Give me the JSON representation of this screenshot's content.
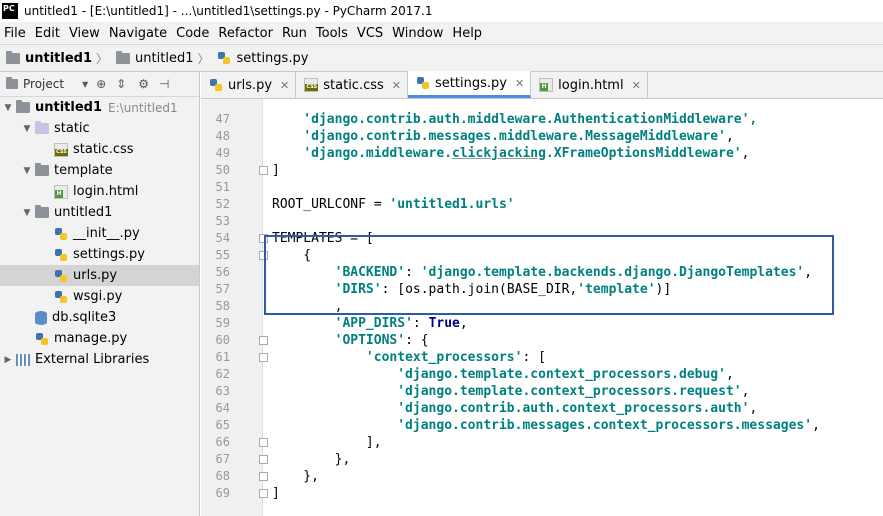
{
  "window": {
    "title": "untitled1 - [E:\\untitled1] - ...\\untitled1\\settings.py - PyCharm 2017.1",
    "app_icon_text": "PC"
  },
  "menu": [
    {
      "label": "File"
    },
    {
      "label": "Edit"
    },
    {
      "label": "View"
    },
    {
      "label": "Navigate"
    },
    {
      "label": "Code"
    },
    {
      "label": "Refactor"
    },
    {
      "label": "Run"
    },
    {
      "label": "Tools"
    },
    {
      "label": "VCS"
    },
    {
      "label": "Window"
    },
    {
      "label": "Help"
    }
  ],
  "breadcrumb": [
    {
      "label": "untitled1",
      "bold": true
    },
    {
      "label": "untitled1"
    },
    {
      "label": "settings.py"
    }
  ],
  "project_panel": {
    "title": "Project",
    "tree": [
      {
        "label": "untitled1",
        "path": "E:\\untitled1",
        "depth": 0,
        "expanded": true,
        "icon": "folder-icon"
      },
      {
        "label": "static",
        "depth": 1,
        "expanded": true,
        "icon": "folder-icon"
      },
      {
        "label": "static.css",
        "depth": 2,
        "icon": "css-file-icon"
      },
      {
        "label": "template",
        "depth": 1,
        "expanded": true,
        "icon": "folder-icon"
      },
      {
        "label": "login.html",
        "depth": 2,
        "icon": "html-file-icon"
      },
      {
        "label": "untitled1",
        "depth": 1,
        "expanded": true,
        "icon": "folder-icon"
      },
      {
        "label": "__init__.py",
        "depth": 2,
        "icon": "python-file-icon"
      },
      {
        "label": "settings.py",
        "depth": 2,
        "icon": "python-file-icon"
      },
      {
        "label": "urls.py",
        "depth": 2,
        "icon": "python-file-icon",
        "selected": true
      },
      {
        "label": "wsgi.py",
        "depth": 2,
        "icon": "python-file-icon"
      },
      {
        "label": "db.sqlite3",
        "depth": 1,
        "icon": "database-icon"
      },
      {
        "label": "manage.py",
        "depth": 1,
        "icon": "python-file-icon"
      },
      {
        "label": "External Libraries",
        "depth": 0,
        "expanded": false,
        "icon": "library-icon"
      }
    ]
  },
  "tabs": [
    {
      "label": "urls.py",
      "icon": "python-file-icon"
    },
    {
      "label": "static.css",
      "icon": "css-file-icon"
    },
    {
      "label": "settings.py",
      "icon": "python-file-icon",
      "active": true
    },
    {
      "label": "login.html",
      "icon": "html-file-icon"
    }
  ],
  "code_lines": [
    {
      "n": "47",
      "segs": [
        [
          "s",
          "    'django.contrib.auth.middleware.AuthenticationMiddleware',"
        ]
      ]
    },
    {
      "n": "48",
      "segs": [
        [
          "p",
          "    "
        ],
        [
          "s",
          "'django.contrib.messages.middleware.MessageMiddleware'"
        ],
        [
          "p",
          ","
        ]
      ]
    },
    {
      "n": "49",
      "segs": [
        [
          "p",
          "    "
        ],
        [
          "s",
          "'django.middleware."
        ],
        [
          "su",
          "clickjacking"
        ],
        [
          "s",
          ".XFrameOptionsMiddleware'"
        ],
        [
          "p",
          ","
        ]
      ]
    },
    {
      "n": "50",
      "segs": [
        [
          "p",
          "]"
        ]
      ],
      "fold": true
    },
    {
      "n": "51",
      "segs": []
    },
    {
      "n": "52",
      "segs": [
        [
          "p",
          "ROOT_URLCONF = "
        ],
        [
          "s",
          "'untitled1.urls'"
        ]
      ]
    },
    {
      "n": "53",
      "segs": []
    },
    {
      "n": "54",
      "segs": [
        [
          "p",
          "TEMPLATES = ["
        ]
      ],
      "fold": true
    },
    {
      "n": "55",
      "segs": [
        [
          "p",
          "    {"
        ]
      ],
      "fold": true
    },
    {
      "n": "56",
      "segs": [
        [
          "p",
          "        "
        ],
        [
          "s",
          "'BACKEND'"
        ],
        [
          "p",
          ": "
        ],
        [
          "s",
          "'django.template.backends.django.DjangoTemplates'"
        ],
        [
          "p",
          ","
        ]
      ]
    },
    {
      "n": "57",
      "segs": [
        [
          "p",
          "        "
        ],
        [
          "s",
          "'DIRS'"
        ],
        [
          "p",
          ": [os.path.join(BASE_DIR,"
        ],
        [
          "s",
          "'template'"
        ],
        [
          "p",
          ")]"
        ]
      ]
    },
    {
      "n": "58",
      "segs": [
        [
          "p",
          "        ,"
        ]
      ]
    },
    {
      "n": "59",
      "segs": [
        [
          "p",
          "        "
        ],
        [
          "s",
          "'APP_DIRS'"
        ],
        [
          "p",
          ": "
        ],
        [
          "k",
          "True"
        ],
        [
          "p",
          ","
        ]
      ]
    },
    {
      "n": "60",
      "segs": [
        [
          "p",
          "        "
        ],
        [
          "s",
          "'OPTIONS'"
        ],
        [
          "p",
          ": {"
        ]
      ],
      "fold": true
    },
    {
      "n": "61",
      "segs": [
        [
          "p",
          "            "
        ],
        [
          "s",
          "'context_processors'"
        ],
        [
          "p",
          ": ["
        ]
      ],
      "fold": true
    },
    {
      "n": "62",
      "segs": [
        [
          "p",
          "                "
        ],
        [
          "s",
          "'django.template.context_processors.debug'"
        ],
        [
          "p",
          ","
        ]
      ]
    },
    {
      "n": "63",
      "segs": [
        [
          "p",
          "                "
        ],
        [
          "s",
          "'django.template.context_processors.request'"
        ],
        [
          "p",
          ","
        ]
      ]
    },
    {
      "n": "64",
      "segs": [
        [
          "p",
          "                "
        ],
        [
          "s",
          "'django.contrib.auth.context_processors.auth'"
        ],
        [
          "p",
          ","
        ]
      ]
    },
    {
      "n": "65",
      "segs": [
        [
          "p",
          "                "
        ],
        [
          "s",
          "'django.contrib.messages.context_processors.messages'"
        ],
        [
          "p",
          ","
        ]
      ]
    },
    {
      "n": "66",
      "segs": [
        [
          "p",
          "            ],"
        ]
      ],
      "fold": true
    },
    {
      "n": "67",
      "segs": [
        [
          "p",
          "        },"
        ]
      ],
      "fold": true
    },
    {
      "n": "68",
      "segs": [
        [
          "p",
          "    },"
        ]
      ],
      "fold": true
    },
    {
      "n": "69",
      "segs": [
        [
          "p",
          "]"
        ]
      ],
      "fold": true
    }
  ],
  "colors": {
    "string": "#008080",
    "keyword": "#000080",
    "highlight_box": "#2e5aa7",
    "active_tab_underline": "#4a8ce0"
  }
}
